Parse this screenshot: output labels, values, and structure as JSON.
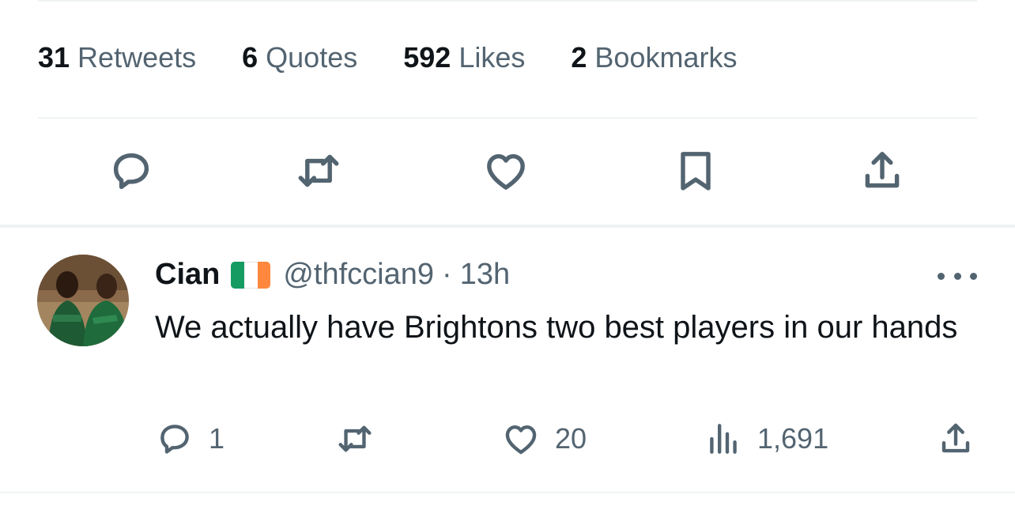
{
  "tweet": {
    "stats": [
      {
        "count": "31",
        "label": "Retweets"
      },
      {
        "count": "6",
        "label": "Quotes"
      },
      {
        "count": "592",
        "label": "Likes"
      },
      {
        "count": "2",
        "label": "Bookmarks"
      }
    ],
    "actions": [
      {
        "icon": "reply-icon"
      },
      {
        "icon": "retweet-icon"
      },
      {
        "icon": "like-icon"
      },
      {
        "icon": "bookmark-icon"
      },
      {
        "icon": "share-icon"
      }
    ]
  },
  "reply": {
    "author_name": "Cian",
    "flag": {
      "icon": "ireland-flag-icon",
      "colors": [
        "#169b62",
        "#ffffff",
        "#ff883e"
      ]
    },
    "handle": "@thfccian9",
    "separator": "·",
    "time": "13h",
    "text": "We actually have Brightons two best players in our hands",
    "actions": {
      "reply_count": "1",
      "retweet_count": "",
      "like_count": "20",
      "views_count": "1,691"
    }
  },
  "colors": {
    "text_primary": "#0f1419",
    "text_secondary": "#536471",
    "divider": "#eff3f4"
  }
}
